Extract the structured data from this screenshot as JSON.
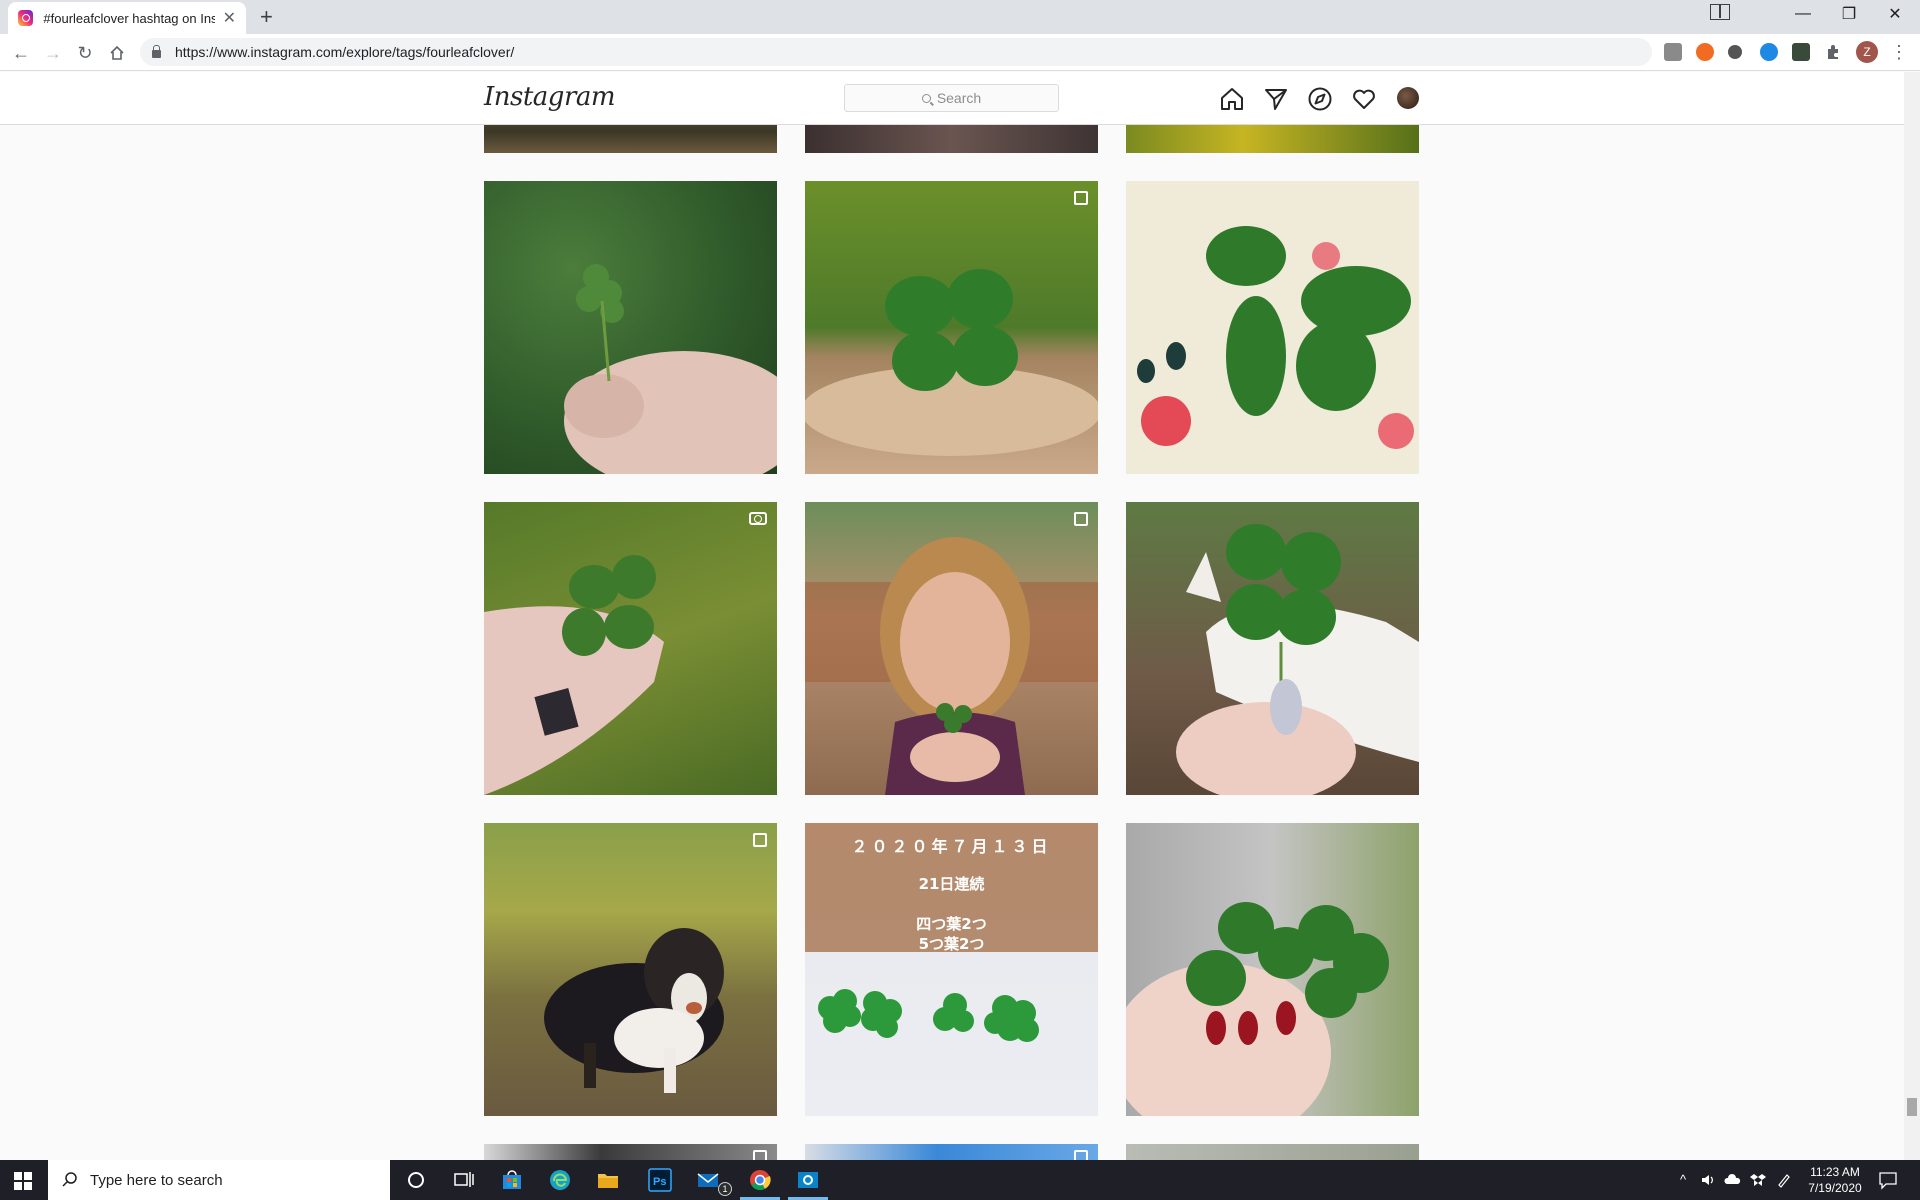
{
  "browser": {
    "tab_title": "#fourleafclover hashtag on Instagram",
    "tab_close": "✕",
    "new_tab": "+",
    "url": "https://www.instagram.com/explore/tags/fourleafclover/",
    "window_minimize": "—",
    "window_restore": "❐",
    "window_close": "✕",
    "profile_initial": "Z",
    "menu": "⋮",
    "nav_back": "←",
    "nav_forward": "→",
    "nav_reload": "↻"
  },
  "instagram": {
    "logo": "Instagram",
    "search_placeholder": "Search",
    "nav_icons": [
      "home-icon",
      "direct-icon",
      "explore-icon",
      "activity-icon",
      "profile-avatar"
    ]
  },
  "grid": {
    "posts": [
      {
        "id": "row1-1",
        "kind": "image",
        "desc": "clover-in-fingers-grass"
      },
      {
        "id": "row1-2",
        "kind": "carousel",
        "desc": "clover-on-wood-stump"
      },
      {
        "id": "row1-3",
        "kind": "image",
        "desc": "clover-on-floral-fabric"
      },
      {
        "id": "row2-1",
        "kind": "video",
        "desc": "clover-held-tattoo-hand"
      },
      {
        "id": "row2-2",
        "kind": "carousel",
        "desc": "girl-holding-clover"
      },
      {
        "id": "row2-3",
        "kind": "image",
        "desc": "clover-white-dog"
      },
      {
        "id": "row3-1",
        "kind": "carousel",
        "desc": "australian-shepherd-dog"
      },
      {
        "id": "row3-2",
        "kind": "image",
        "desc": "clovers-on-white-date-text"
      },
      {
        "id": "row3-3",
        "kind": "image",
        "desc": "clovers-red-nails"
      }
    ],
    "japanese_caption": {
      "line1": "２０２０年７月１３日",
      "line2": "21日連続",
      "line3": "四つ葉2つ",
      "line4": "5つ葉2つ"
    }
  },
  "taskbar": {
    "search_placeholder": "Type here to search",
    "time": "11:23 AM",
    "date": "7/19/2020",
    "mail_badge": "1"
  }
}
